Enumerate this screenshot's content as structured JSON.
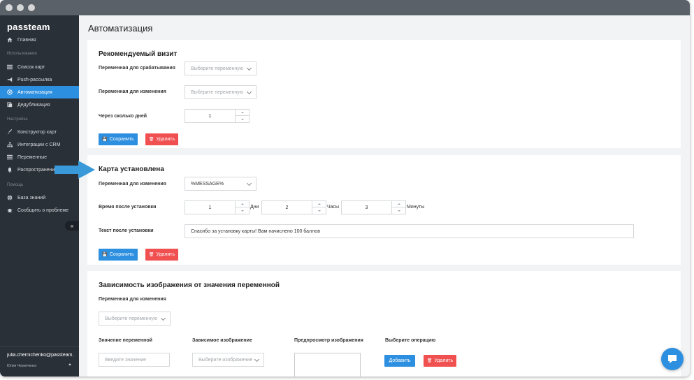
{
  "app": {
    "logo": "passteam"
  },
  "sidebar": {
    "sections": [
      "Использование",
      "Настройка",
      "Помощь"
    ],
    "items": [
      {
        "label": "Главная",
        "icon": "home-icon"
      },
      {
        "label": "Список карт",
        "icon": "list-icon"
      },
      {
        "label": "Push-рассылка",
        "icon": "megaphone-icon"
      },
      {
        "label": "Автоматизация",
        "icon": "automation-icon",
        "active": true
      },
      {
        "label": "Дедубликация",
        "icon": "copy-icon"
      },
      {
        "label": "Конструктор карт",
        "icon": "brush-icon"
      },
      {
        "label": "Интеграции с CRM",
        "icon": "sitemap-icon"
      },
      {
        "label": "Переменные",
        "icon": "bars-icon"
      },
      {
        "label": "Распространение",
        "icon": "bell-icon"
      },
      {
        "label": "База знаний",
        "icon": "globe-icon"
      },
      {
        "label": "Сообщить о проблеме",
        "icon": "bug-icon"
      }
    ],
    "collapse_label": "«",
    "user": {
      "email": "julia.chernichenko@passteam.ru",
      "name": "Юлия Черниченко"
    }
  },
  "main": {
    "title": "Автоматизация",
    "card1": {
      "title": "Рекомендуемый визит",
      "trigger_label": "Переменная для срабатывания",
      "trigger_placeholder": "Выберите переменную",
      "change_label": "Переменная для изменения",
      "change_placeholder": "Выберите переменную",
      "days_label": "Через сколько дней",
      "days_value": "1",
      "save": "Сохранить",
      "delete": "Удалить"
    },
    "card2": {
      "title": "Карта установлена",
      "change_label": "Переменная для изменения",
      "change_value": "%MESSAGE%",
      "time_label": "Время после установки",
      "days_value": "1",
      "days_unit": "Дни",
      "hours_value": "2",
      "hours_unit": "Часы",
      "minutes_value": "3",
      "minutes_unit": "Минуты",
      "text_label": "Текст после установки",
      "text_value": "Спасибо за установку карты! Вам начислено 100 баллов",
      "save": "Сохранить",
      "delete": "Удалить"
    },
    "card3": {
      "title": "Зависимость изображения от значения переменной",
      "change_label": "Переменная для изменения",
      "change_placeholder": "Выберите переменную",
      "col_value": "Значение переменной",
      "col_image": "Зависимое изображение",
      "col_preview": "Предпросмотр изображения",
      "col_operation": "Выберите операцию",
      "value_placeholder": "Введите значение",
      "image_placeholder": "Выберите изображение",
      "add": "Добавить",
      "delete": "Удалить"
    }
  },
  "colors": {
    "accent": "#2d8fe0",
    "danger": "#f05050",
    "sidebar_bg": "#2a3038"
  }
}
